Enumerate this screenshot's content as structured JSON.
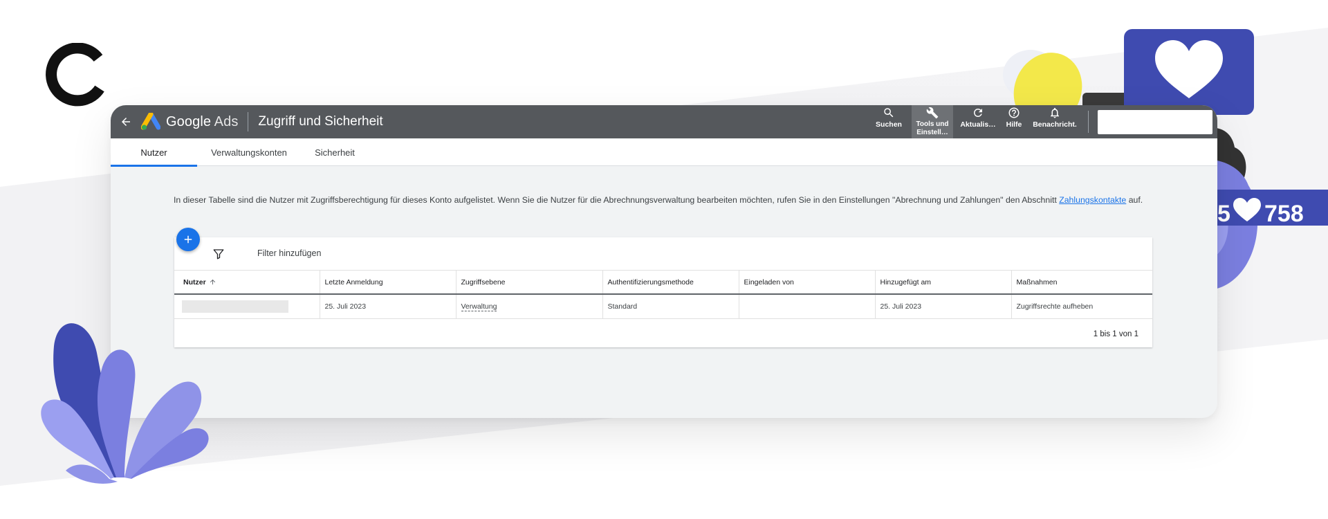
{
  "app": {
    "product_name_bold": "Google",
    "product_name_light": "Ads",
    "page_title": "Zugriff und Sicherheit"
  },
  "topbar_actions": [
    {
      "label": "Suchen",
      "icon": "search-icon"
    },
    {
      "label": "Tools und Einstell…",
      "icon": "wrench-icon",
      "active": true
    },
    {
      "label": "Aktualis…",
      "icon": "refresh-icon"
    },
    {
      "label": "Hilfe",
      "icon": "help-icon"
    },
    {
      "label": "Benachricht.",
      "icon": "bell-icon"
    }
  ],
  "tabs": [
    {
      "label": "Nutzer",
      "active": true
    },
    {
      "label": "Verwaltungskonten"
    },
    {
      "label": "Sicherheit"
    }
  ],
  "info": {
    "text": "In dieser Tabelle sind die Nutzer mit Zugriffsberechtigung für dieses Konto aufgelistet. Wenn Sie die Nutzer für die Abrechnungsverwaltung bearbeiten möchten, rufen Sie in den Einstellungen \"Abrechnung und Zahlungen\" den Abschnitt ",
    "link": "Zahlungskontakte",
    "suffix": " auf."
  },
  "filter": {
    "label": "Filter hinzufügen"
  },
  "table": {
    "columns": [
      "Nutzer",
      "Letzte Anmeldung",
      "Zugriffsebene",
      "Authentifizierungsmethode",
      "Eingeladen von",
      "Hinzugefügt am",
      "Maßnahmen"
    ],
    "rows": [
      {
        "last_login": "25. Juli 2023",
        "access_level": "Verwaltung",
        "auth_method": "Standard",
        "invited_by": "",
        "added_on": "25. Juli 2023",
        "action": "Zugriffsrechte aufheben"
      }
    ]
  },
  "pagination": "1 bis 1 von 1",
  "deco": {
    "counter": "758",
    "counter_partial": "5"
  },
  "colors": {
    "topbar": "#55585c",
    "accent_blue": "#1a73e8",
    "deco_indigo": "#3f4bb0",
    "deco_lavender": "#7b7fe0",
    "deco_yellow": "#f3e84a"
  }
}
